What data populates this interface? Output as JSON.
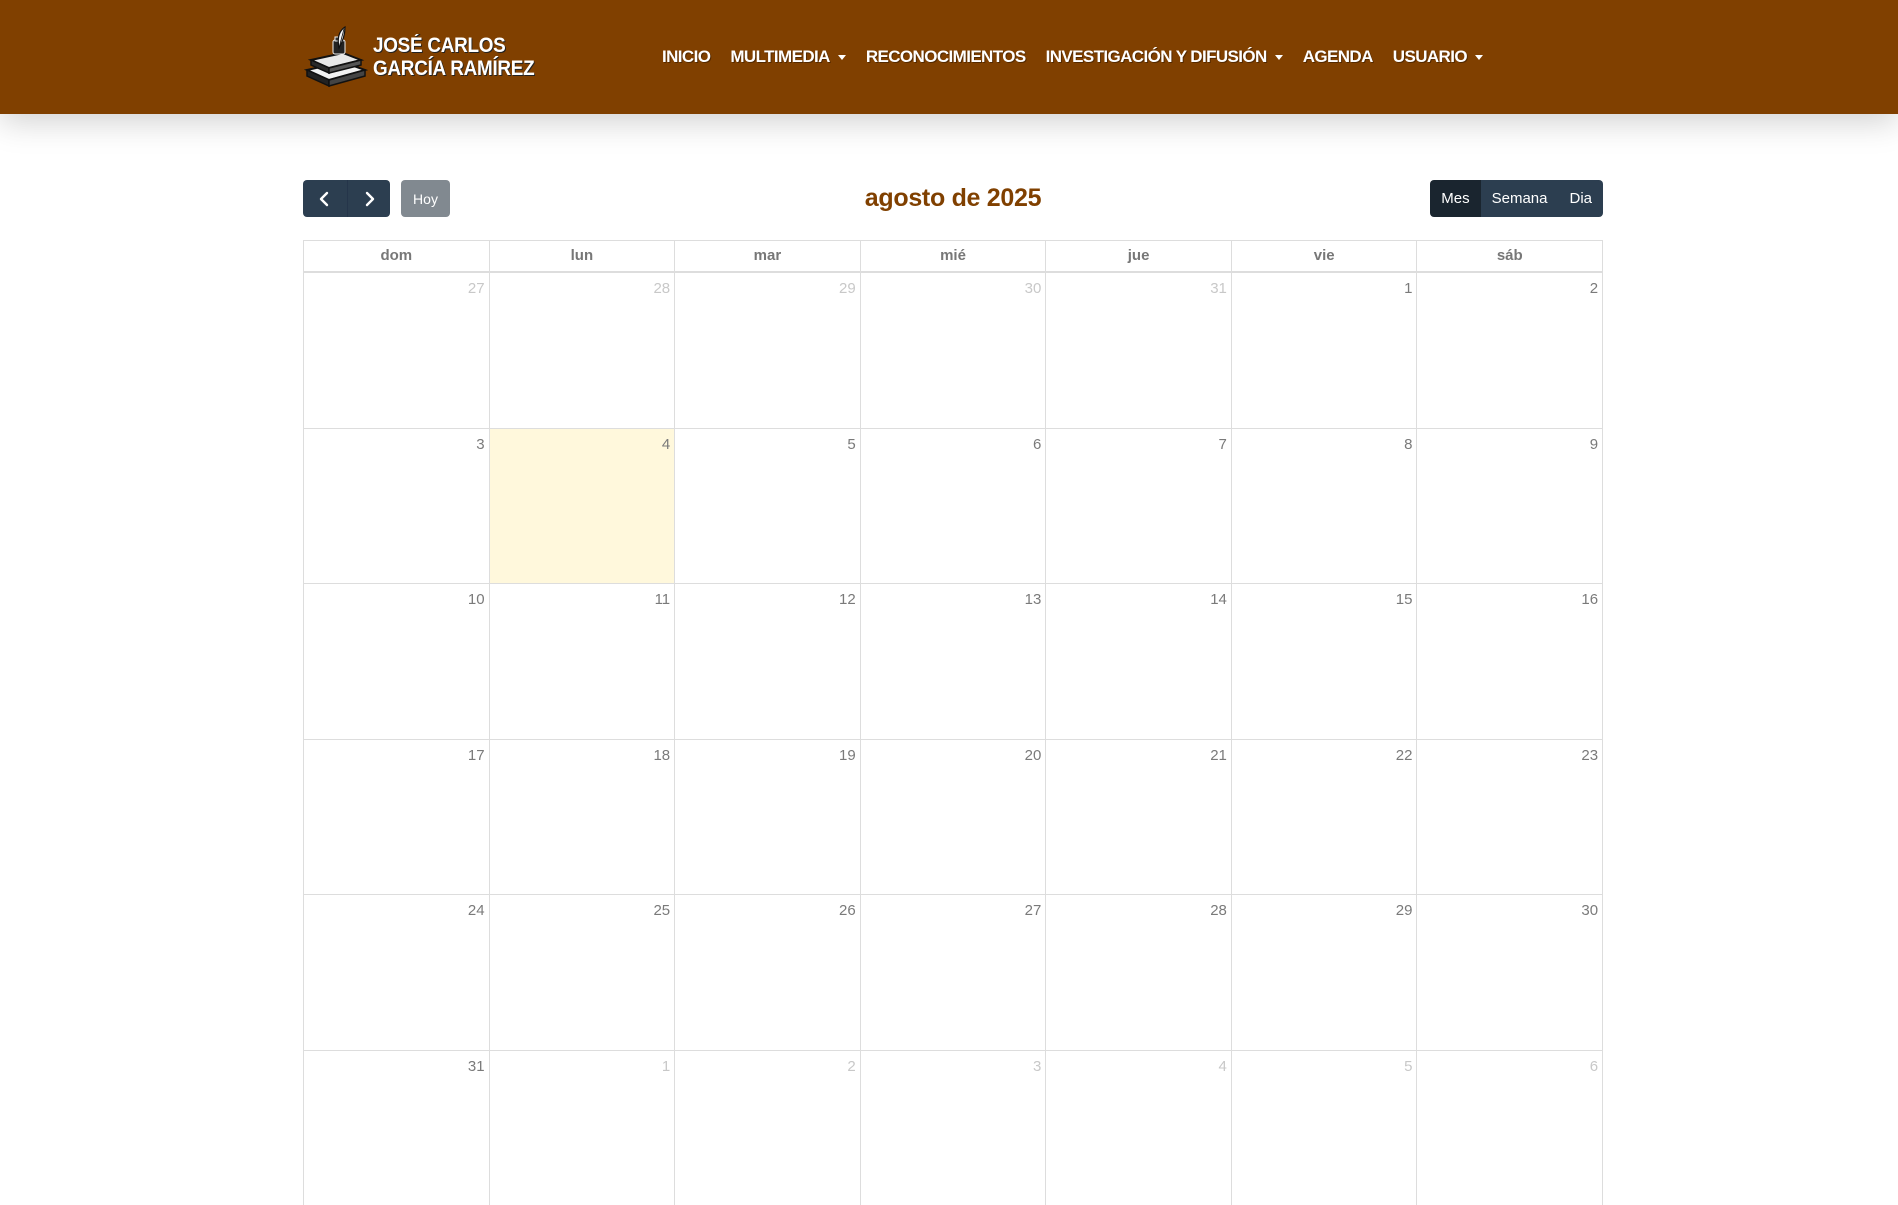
{
  "header": {
    "brand_line1": "JOSÉ CARLOS",
    "brand_line2": "GARCÍA RAMÍREZ",
    "bg_color": "#804000",
    "nav": [
      {
        "label": "INICIO",
        "dropdown": false
      },
      {
        "label": "MULTIMEDIA",
        "dropdown": true
      },
      {
        "label": "RECONOCIMIENTOS",
        "dropdown": false
      },
      {
        "label": "INVESTIGACIÓN Y DIFUSIÓN",
        "dropdown": true
      },
      {
        "label": "AGENDA",
        "dropdown": false
      },
      {
        "label": "USUARIO",
        "dropdown": true
      }
    ]
  },
  "toolbar": {
    "prev_icon": "chevron-left-icon",
    "next_icon": "chevron-right-icon",
    "today_label": "Hoy",
    "title": "agosto de 2025",
    "views": [
      {
        "label": "Mes",
        "active": true
      },
      {
        "label": "Semana",
        "active": false
      },
      {
        "label": "Dia",
        "active": false
      }
    ]
  },
  "calendar": {
    "weekdays": [
      "dom",
      "lun",
      "mar",
      "mié",
      "jue",
      "vie",
      "sáb"
    ],
    "today_color": "#fff8dc",
    "weeks": [
      [
        {
          "d": "27",
          "other": true
        },
        {
          "d": "28",
          "other": true
        },
        {
          "d": "29",
          "other": true
        },
        {
          "d": "30",
          "other": true
        },
        {
          "d": "31",
          "other": true
        },
        {
          "d": "1"
        },
        {
          "d": "2"
        }
      ],
      [
        {
          "d": "3"
        },
        {
          "d": "4",
          "today": true
        },
        {
          "d": "5"
        },
        {
          "d": "6"
        },
        {
          "d": "7"
        },
        {
          "d": "8"
        },
        {
          "d": "9"
        }
      ],
      [
        {
          "d": "10"
        },
        {
          "d": "11"
        },
        {
          "d": "12"
        },
        {
          "d": "13"
        },
        {
          "d": "14"
        },
        {
          "d": "15"
        },
        {
          "d": "16"
        }
      ],
      [
        {
          "d": "17"
        },
        {
          "d": "18"
        },
        {
          "d": "19"
        },
        {
          "d": "20"
        },
        {
          "d": "21"
        },
        {
          "d": "22"
        },
        {
          "d": "23"
        }
      ],
      [
        {
          "d": "24"
        },
        {
          "d": "25"
        },
        {
          "d": "26"
        },
        {
          "d": "27"
        },
        {
          "d": "28"
        },
        {
          "d": "29"
        },
        {
          "d": "30"
        }
      ],
      [
        {
          "d": "31"
        },
        {
          "d": "1",
          "other": true
        },
        {
          "d": "2",
          "other": true
        },
        {
          "d": "3",
          "other": true
        },
        {
          "d": "4",
          "other": true
        },
        {
          "d": "5",
          "other": true
        },
        {
          "d": "6",
          "other": true
        }
      ]
    ]
  }
}
